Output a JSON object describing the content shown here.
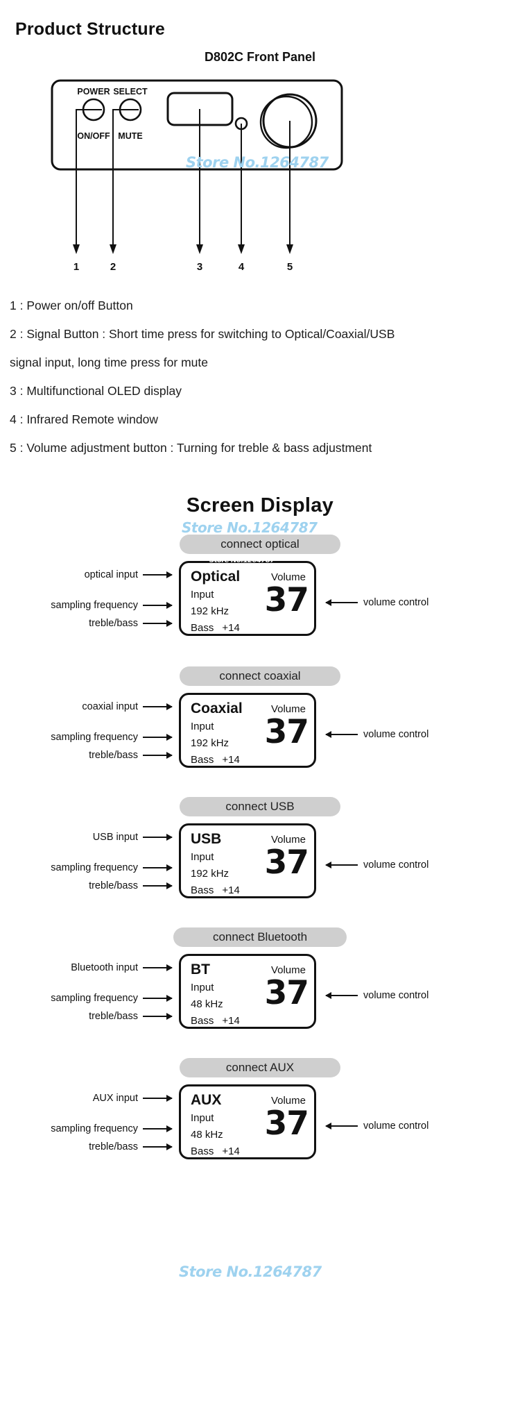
{
  "headings": {
    "product_structure": "Product Structure",
    "front_panel": "D802C Front Panel",
    "screen_display": "Screen Display"
  },
  "watermark": {
    "text": "Store No.1264787"
  },
  "front_panel": {
    "labels": {
      "power_top": "POWER",
      "power_bottom": "ON/OFF",
      "select_top": "SELECT",
      "select_bottom": "MUTE"
    },
    "callout_numbers": [
      "1",
      "2",
      "3",
      "4",
      "5"
    ]
  },
  "descriptions": [
    "1 : Power on/off Button",
    "2 : Signal Button : Short time press for switching to Optical/Coaxial/USB",
    "signal input, long time press for mute",
    "3 : Multifunctional OLED display",
    "4 : Infrared Remote window",
    "5 : Volume adjustment button : Turning for treble & bass adjustment"
  ],
  "callout_labels": {
    "sampling_frequency": "sampling frequency",
    "treble_bass": "treble/bass",
    "volume_control": "volume control"
  },
  "screen_blocks": [
    {
      "pill": "connect optical",
      "input_label": "optical  input",
      "source": "Optical",
      "volume_label": "Volume",
      "input_text": "Input",
      "frequency": "192 kHz",
      "bass_label": "Bass",
      "bass_value": "+14",
      "volume_value": "37"
    },
    {
      "pill": "connect coaxial",
      "input_label": "coaxial  input",
      "source": "Coaxial",
      "volume_label": "Volume",
      "input_text": "Input",
      "frequency": "192 kHz",
      "bass_label": "Bass",
      "bass_value": "+14",
      "volume_value": "37"
    },
    {
      "pill": "connect USB",
      "input_label": "USB  input",
      "source": "USB",
      "volume_label": "Volume",
      "input_text": "Input",
      "frequency": "192 kHz",
      "bass_label": "Bass",
      "bass_value": "+14",
      "volume_value": "37"
    },
    {
      "pill": "connect Bluetooth",
      "input_label": "Bluetooth  input",
      "source": "BT",
      "volume_label": "Volume",
      "input_text": "Input",
      "frequency": "48 kHz",
      "bass_label": "Bass",
      "bass_value": "+14",
      "volume_value": "37"
    },
    {
      "pill": "connect AUX",
      "input_label": "AUX  input",
      "source": "AUX",
      "volume_label": "Volume",
      "input_text": "Input",
      "frequency": "48 kHz",
      "bass_label": "Bass",
      "bass_value": "+14",
      "volume_value": "37"
    }
  ],
  "colors": {
    "watermark_blue": "#9ed2ef",
    "pill_gray": "#cfcfcf",
    "line_black": "#111111"
  }
}
